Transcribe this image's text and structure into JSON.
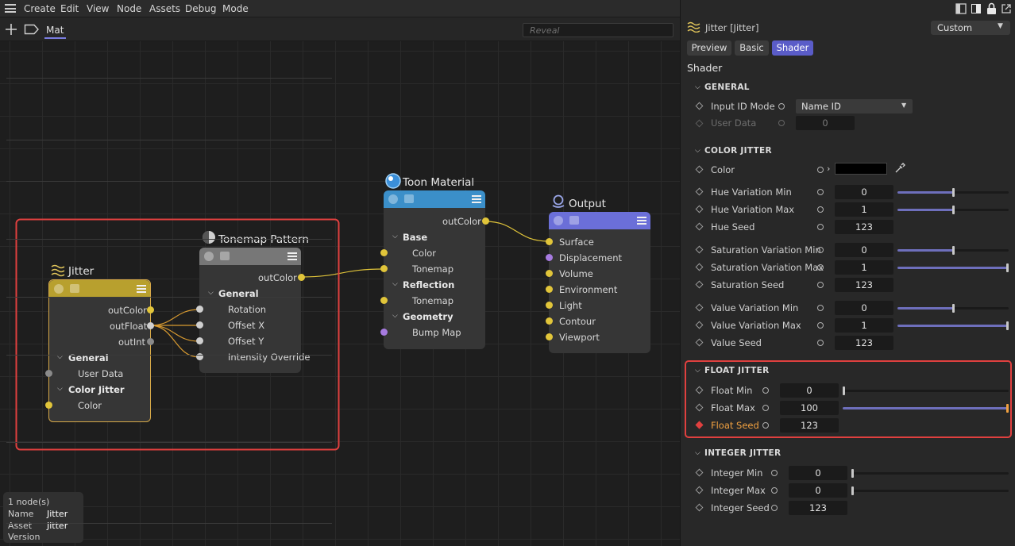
{
  "menu": [
    "Create",
    "Edit",
    "View",
    "Node",
    "Assets",
    "Debug",
    "Mode"
  ],
  "tabs": {
    "active": "Mat"
  },
  "search": {
    "placeholder": "Reveal"
  },
  "nodes": {
    "jitter": {
      "title": "Jitter",
      "outputs": [
        "outColor",
        "outFloat",
        "outInt"
      ],
      "sections": [
        {
          "label": "General",
          "ports": [
            "User Data"
          ]
        },
        {
          "label": "Color Jitter",
          "ports": [
            "Color"
          ]
        }
      ]
    },
    "tonemap": {
      "title": "Tonemap Pattern",
      "output": "outColor",
      "section": "General",
      "ports": [
        "Rotation",
        "Offset X",
        "Offset Y",
        "Intensity Override"
      ]
    },
    "toon": {
      "title": "Toon Material",
      "output": "outColor",
      "sections": [
        {
          "label": "Base",
          "ports": [
            "Color",
            "Tonemap"
          ]
        },
        {
          "label": "Reflection",
          "ports": [
            "Tonemap"
          ]
        },
        {
          "label": "Geometry",
          "ports": [
            "Bump Map"
          ]
        }
      ]
    },
    "output": {
      "title": "Output",
      "ports": [
        "Surface",
        "Displacement",
        "Volume",
        "Environment",
        "Light",
        "Contour",
        "Viewport"
      ]
    }
  },
  "info": {
    "count": "1 node(s)",
    "rows": [
      {
        "key": "Name",
        "value": "Jitter"
      },
      {
        "key": "Asset",
        "value": "Jitter"
      },
      {
        "key": "Version",
        "value": ""
      }
    ]
  },
  "panel": {
    "title": "Jitter [Jitter]",
    "preset": "Custom",
    "tabs": [
      "Preview",
      "Basic",
      "Shader"
    ],
    "active_tab": "Shader",
    "section_title": "Shader",
    "general": {
      "header": "GENERAL",
      "input_id_mode": {
        "label": "Input ID Mode",
        "value": "Name ID"
      },
      "user_data": {
        "label": "User Data",
        "value": "0"
      }
    },
    "color_jitter": {
      "header": "COLOR JITTER",
      "color_label": "Color",
      "color_value": "#000000",
      "rows": [
        {
          "label": "Hue Variation Min",
          "value": "0",
          "level": 0.5
        },
        {
          "label": "Hue Variation Max",
          "value": "1",
          "level": 0.5
        },
        {
          "label": "Hue Seed",
          "value": "123"
        },
        {
          "label": "Saturation Variation Min",
          "value": "0",
          "level": 0.5
        },
        {
          "label": "Saturation Variation Max",
          "value": "1",
          "level": 1.0
        },
        {
          "label": "Saturation Seed",
          "value": "123"
        },
        {
          "label": "Value Variation Min",
          "value": "0",
          "level": 0.5
        },
        {
          "label": "Value Variation Max",
          "value": "1",
          "level": 1.0
        },
        {
          "label": "Value Seed",
          "value": "123"
        }
      ]
    },
    "float_jitter": {
      "header": "FLOAT JITTER",
      "rows": [
        {
          "label": "Float Min",
          "value": "0",
          "level": 0.0
        },
        {
          "label": "Float Max",
          "value": "100",
          "level": 1.0
        },
        {
          "label": "Float Seed",
          "value": "123"
        }
      ]
    },
    "integer_jitter": {
      "header": "INTEGER JITTER",
      "rows": [
        {
          "label": "Integer Min",
          "value": "0",
          "level": 0.0
        },
        {
          "label": "Integer Max",
          "value": "0",
          "level": 0.0
        },
        {
          "label": "Integer Seed",
          "value": "123"
        }
      ]
    }
  },
  "colors": {
    "accent": "#5a5cc8",
    "jitter_header": "#b8a02e",
    "toon_header": "#3b8fc9",
    "output_header": "#6b6fd8",
    "tonemap_header": "#777777",
    "highlight_red": "#e0403f",
    "seed_orange": "#f0a040"
  }
}
